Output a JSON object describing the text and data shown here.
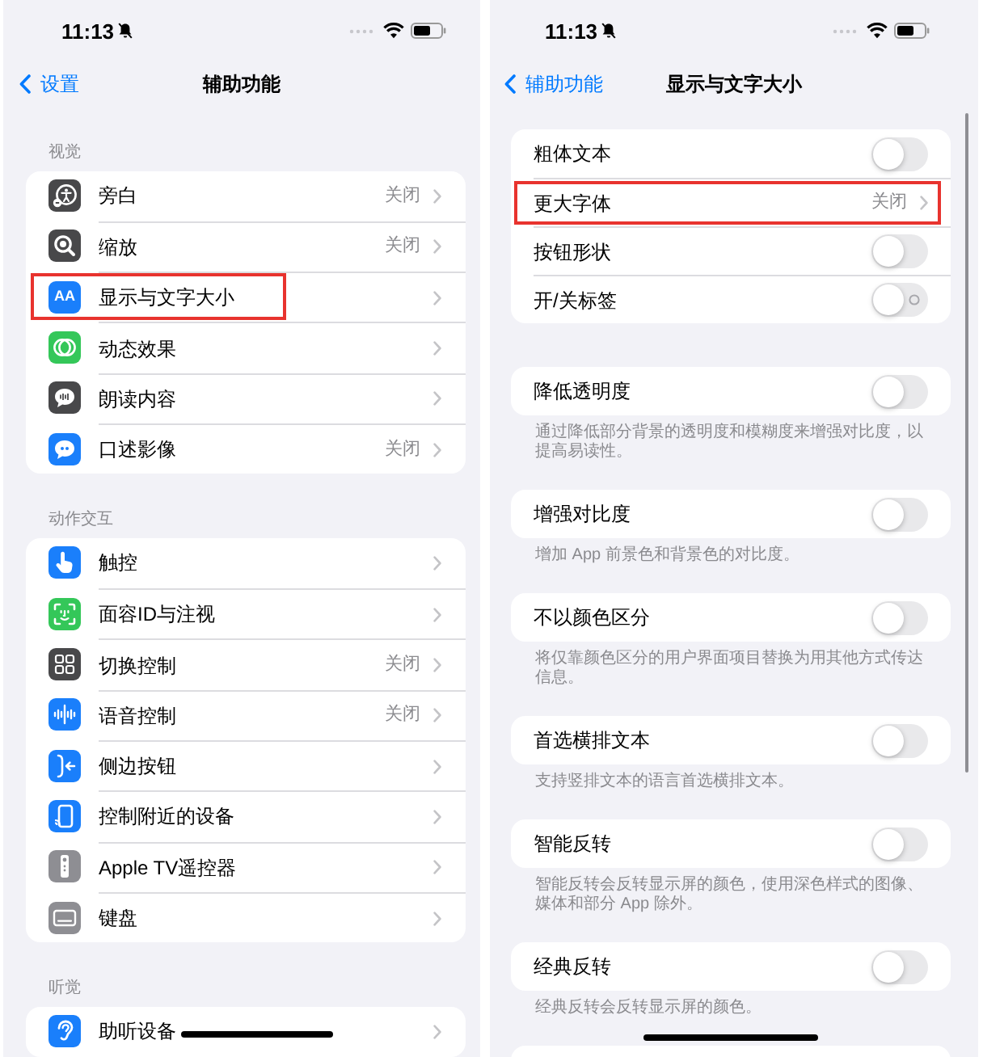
{
  "screen_accessibility": {
    "status_bar": {
      "time": "11:13"
    },
    "nav": {
      "back": "设置",
      "title": "辅助功能"
    },
    "groups": [
      {
        "header": "视觉",
        "rows": [
          {
            "label": "旁白",
            "value": "关闭",
            "highlighted": false
          },
          {
            "label": "缩放",
            "value": "关闭",
            "highlighted": false
          },
          {
            "label": "显示与文字大小",
            "icon_text": "AA",
            "highlighted": true
          },
          {
            "label": "动态效果",
            "highlighted": false
          },
          {
            "label": "朗读内容",
            "highlighted": false
          },
          {
            "label": "口述影像",
            "value": "关闭",
            "highlighted": false
          }
        ]
      },
      {
        "header": "动作交互",
        "rows": [
          {
            "label": "触控",
            "highlighted": false
          },
          {
            "label": "面容ID与注视",
            "highlighted": false
          },
          {
            "label": "切换控制",
            "value": "关闭",
            "highlighted": false
          },
          {
            "label": "语音控制",
            "value": "关闭",
            "highlighted": false
          },
          {
            "label": "侧边按钮",
            "highlighted": false
          },
          {
            "label": "控制附近的设备",
            "highlighted": false
          },
          {
            "label": "Apple TV遥控器",
            "highlighted": false
          },
          {
            "label": "键盘",
            "highlighted": false
          }
        ]
      },
      {
        "header": "听觉",
        "rows": [
          {
            "label": "助听设备",
            "highlighted": false
          }
        ]
      }
    ]
  },
  "screen_display_text_size": {
    "status_bar": {
      "time": "11:13"
    },
    "nav": {
      "back": "辅助功能",
      "title": "显示与文字大小"
    },
    "groups": [
      {
        "rows": [
          {
            "kind": "toggle",
            "label": "粗体文本",
            "on": false,
            "off_label": false,
            "highlighted": false
          },
          {
            "kind": "link",
            "label": "更大字体",
            "value": "关闭",
            "highlighted": true
          },
          {
            "kind": "toggle",
            "label": "按钮形状",
            "on": false,
            "off_label": false,
            "highlighted": false
          },
          {
            "kind": "toggle",
            "label": "开/关标签",
            "on": false,
            "off_label": true,
            "highlighted": false
          }
        ]
      },
      {
        "rows": [
          {
            "kind": "toggle",
            "label": "降低透明度",
            "on": false,
            "off_label": false,
            "highlighted": false
          }
        ],
        "footer": "通过降低部分背景的透明度和模糊度来增强对比度，以提高易读性。"
      },
      {
        "rows": [
          {
            "kind": "toggle",
            "label": "增强对比度",
            "on": false,
            "off_label": false,
            "highlighted": false
          }
        ],
        "footer": "增加 App 前景色和背景色的对比度。"
      },
      {
        "rows": [
          {
            "kind": "toggle",
            "label": "不以颜色区分",
            "on": false,
            "off_label": false,
            "highlighted": false
          }
        ],
        "footer": "将仅靠颜色区分的用户界面项目替换为用其他方式传达信息。"
      },
      {
        "rows": [
          {
            "kind": "toggle",
            "label": "首选横排文本",
            "on": false,
            "off_label": false,
            "highlighted": false
          }
        ],
        "footer": "支持竖排文本的语言首选横排文本。"
      },
      {
        "rows": [
          {
            "kind": "toggle",
            "label": "智能反转",
            "on": false,
            "off_label": false,
            "highlighted": false
          }
        ],
        "footer": "智能反转会反转显示屏的颜色，使用深色样式的图像、媒体和部分 App 除外。"
      },
      {
        "rows": [
          {
            "kind": "toggle",
            "label": "经典反转",
            "on": false,
            "off_label": false,
            "highlighted": false
          }
        ],
        "footer": "经典反转会反转显示屏的颜色。"
      }
    ]
  }
}
